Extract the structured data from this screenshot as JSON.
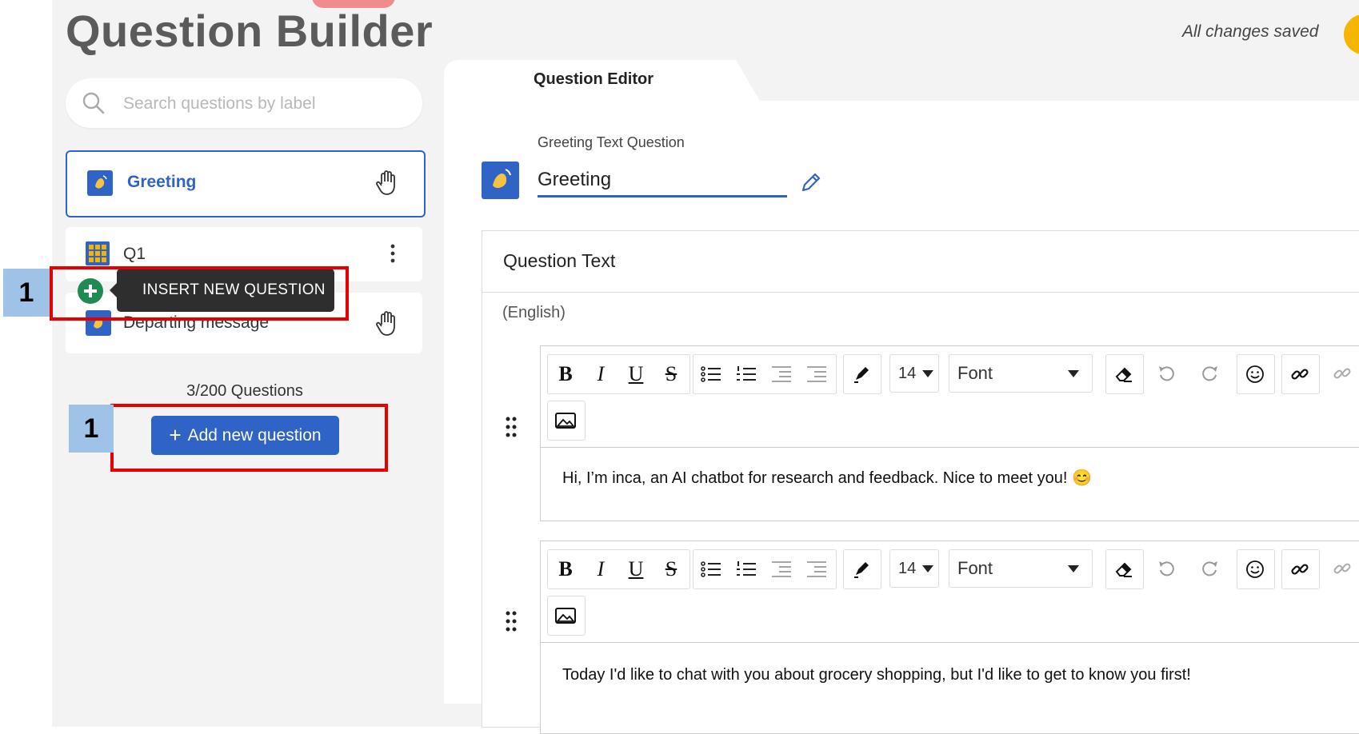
{
  "header": {
    "title": "Question Builder",
    "save_status": "All changes saved"
  },
  "search": {
    "placeholder": "Search questions by label"
  },
  "questions": [
    {
      "label": "Greeting",
      "icon": "waving-hand-icon",
      "action_icon": "hand-icon"
    },
    {
      "label": "Q1",
      "icon": "grid-icon",
      "action_icon": "more-vertical-icon"
    },
    {
      "label": "Departing message",
      "icon": "waving-hand-icon",
      "action_icon": "hand-icon"
    }
  ],
  "tooltip": {
    "insert": "INSERT NEW QUESTION"
  },
  "sidebar": {
    "count": "3/200 Questions",
    "add_button": "Add new question"
  },
  "annotations": {
    "badge1": "1",
    "badge2": "1"
  },
  "editor": {
    "tab": "Question Editor",
    "question_type": "Greeting Text Question",
    "label_value": "Greeting",
    "question_text_title": "Question Text",
    "language": "(English)",
    "font_size": "14",
    "font": "Font",
    "messages": [
      "Hi, I’m inca, an AI chatbot for research and feedback. Nice to meet you! 😊",
      "Today I'd like to chat with you about grocery shopping, but I'd like to get to know you first!"
    ]
  },
  "colors": {
    "accent": "#2f63c6",
    "highlight": "#e60000",
    "badge": "#9fc3e7",
    "insert_green": "#1f8a52",
    "background": "#f3f3f3"
  }
}
